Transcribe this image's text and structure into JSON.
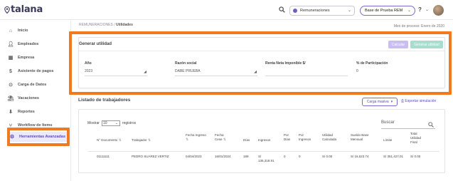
{
  "app": {
    "logo_text": "talana"
  },
  "topbar": {
    "module_select": "Remuneraciones",
    "base_select": "Base de Prueba REM",
    "help_label": "?"
  },
  "sidebar": {
    "items": [
      {
        "label": "Inicio",
        "icon": "home-icon"
      },
      {
        "label": "Empleados",
        "icon": "person-icon"
      },
      {
        "label": "Empresa",
        "icon": "building-icon"
      },
      {
        "label": "Asistente de pagos",
        "icon": "dollar-icon"
      },
      {
        "label": "Carga de Datos",
        "icon": "circle-icon"
      },
      {
        "label": "Vacaciones",
        "icon": "beach-icon"
      },
      {
        "label": "Reportes",
        "icon": "download-icon"
      },
      {
        "label": "Workflow de Items",
        "icon": "workflow-icon"
      },
      {
        "label": "Herramientas Avanzadas",
        "icon": "gear-icon",
        "active": true
      }
    ]
  },
  "breadcrumb": {
    "root": "REMUNERACIONES",
    "sep": "/",
    "current": "Utilidades"
  },
  "period": "Mes de proceso: Enero de 2020",
  "generar": {
    "title": "Generar utilidad",
    "btn_calcular": "Calcular",
    "btn_generar": "Generar utilidad",
    "fields": [
      {
        "label": "Año",
        "value": "2023"
      },
      {
        "label": "Razón social",
        "value": "DABE PRUEBA"
      },
      {
        "label": "Renta Neta Imponible $/",
        "value": ""
      },
      {
        "label": "% de Participación",
        "value": "0"
      }
    ]
  },
  "listado": {
    "title": "Listado de trabajadores",
    "btn_carga": "Carga masiva",
    "btn_exportar": "Exportar simulación",
    "mostrar_label": "Mostrar",
    "mostrar_value": "10",
    "registros_label": "registros",
    "buscar_label": "Buscar",
    "columns": [
      "N° Documento",
      "Trabajador",
      "Fecha Ingreso",
      "Fecha Cese",
      "Días",
      "Ingresos",
      "Por Días",
      "Por Ingresos",
      "Utilidad Calculada",
      "Sueldo Base Mensual",
      "Límite",
      "Total Utilidad Final"
    ],
    "rows": [
      [
        "01111111",
        "PEDRO SUAREZ VERTIZ",
        "04/04/2023",
        "16/01/2024",
        "189",
        "S/ 136,318.91",
        "0",
        "0",
        "S/ 0.00",
        "S/ 16,523.74",
        "S/ 351,427.01",
        "S/ 0.00"
      ]
    ]
  }
}
